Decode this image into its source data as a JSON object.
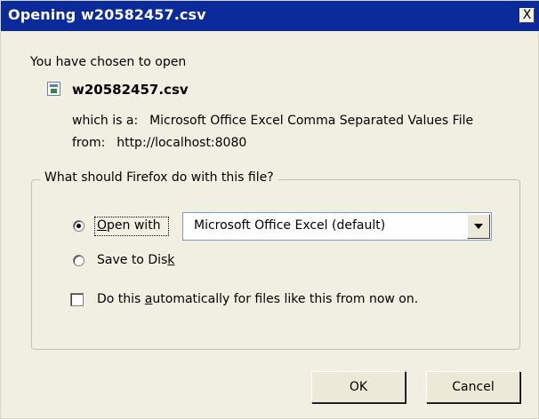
{
  "window": {
    "title": "Opening w20582457.csv",
    "close_glyph": "X"
  },
  "intro": "You have chosen to open",
  "file": {
    "icon": "csv-file-icon",
    "name": "w20582457.csv",
    "type_label": "which is a:",
    "type_value": "Microsoft Office Excel Comma Separated Values File",
    "from_label": "from:",
    "from_value": "http://localhost:8080"
  },
  "action_group": {
    "legend": "What should Firefox do with this file?",
    "open_with": {
      "label_pre": "",
      "label_mnemonic": "O",
      "label_post": "pen with",
      "selected": true
    },
    "application_select": {
      "value": "Microsoft Office Excel (default)"
    },
    "save_to_disk": {
      "label_pre": "Save to Dis",
      "label_mnemonic": "k",
      "label_post": "",
      "selected": false
    },
    "auto_checkbox": {
      "label_pre": "Do this ",
      "label_mnemonic": "a",
      "label_post": "utomatically for files like this from now on.",
      "checked": false
    }
  },
  "buttons": {
    "ok": "OK",
    "cancel": "Cancel"
  }
}
